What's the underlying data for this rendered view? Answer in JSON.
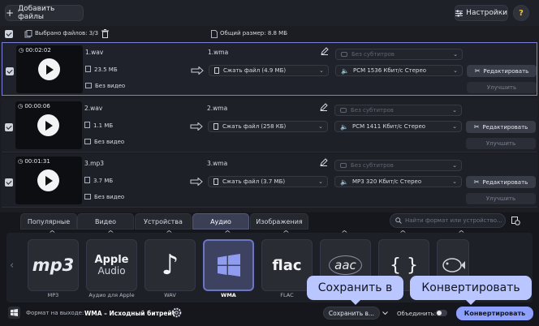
{
  "toolbar": {
    "add_files": "Добавить файлы",
    "settings": "Настройки",
    "help": "?"
  },
  "selection": {
    "selected": "Выбрано файлов: 3/3",
    "total_size": "Общий размер: 8.8 МБ"
  },
  "files": [
    {
      "duration": "00:02:02",
      "name": "1.wav",
      "size": "23.5 МБ",
      "video": "Без видео",
      "out_name": "1.wma",
      "compress": "Сжать файл (4.9 МБ)",
      "subtitles": "Без субтитров",
      "audio": "PCM 1536 Кбит/с Стерео",
      "edit": "Редактировать",
      "improve": "Улучшить"
    },
    {
      "duration": "00:00:06",
      "name": "2.wav",
      "size": "1.1 МБ",
      "video": "Без видео",
      "out_name": "2.wma",
      "compress": "Сжать файл (258 КБ)",
      "subtitles": "Без субтитров",
      "audio": "PCM 1411 Кбит/с Стерео",
      "edit": "Редактировать",
      "improve": "Улучшить"
    },
    {
      "duration": "00:01:31",
      "name": "3.mp3",
      "size": "3.7 МБ",
      "video": "Без видео",
      "out_name": "3.wma",
      "compress": "Сжать файл (3.7 МБ)",
      "subtitles": "Без субтитров",
      "audio": "MP3 320 Кбит/с Стерео",
      "edit": "Редактировать",
      "improve": "Улучшить"
    }
  ],
  "tabs": [
    "Популярные",
    "Видео",
    "Устройства",
    "Аудио",
    "Изображения"
  ],
  "active_tab": "Аудио",
  "search_placeholder": "Найти формат или устройство...",
  "formats": [
    {
      "label": "MP3",
      "icon": "mp3-icon",
      "logo": "mp3"
    },
    {
      "label": "Аудио для Apple",
      "icon": "apple-audio-icon",
      "logo": "Apple",
      "logo2": "Audio"
    },
    {
      "label": "WAV",
      "icon": "music-note-icon"
    },
    {
      "label": "WMA",
      "icon": "windows-logo-icon",
      "active": true
    },
    {
      "label": "FLAC",
      "icon": "flac-icon",
      "logo": "flac"
    },
    {
      "label": "",
      "icon": "aac-icon",
      "logo": "aac"
    },
    {
      "label": "",
      "icon": "curly-braces-icon",
      "logo": "{ }"
    },
    {
      "label": "",
      "icon": "ogg-fish-icon"
    }
  ],
  "footer": {
    "output_label": "Формат на выходе:",
    "output_value": "WMA – Исходный битрейт",
    "save_to": "Сохранить в...",
    "merge": "Объединить:",
    "convert": "Конвертировать"
  },
  "tooltips": {
    "save": "Сохранить в",
    "convert": "Конвертировать"
  },
  "colors": {
    "accent": "#8ea1ff",
    "tooltip": "#b9c6ff",
    "selected_border": "#7a7fd8"
  }
}
